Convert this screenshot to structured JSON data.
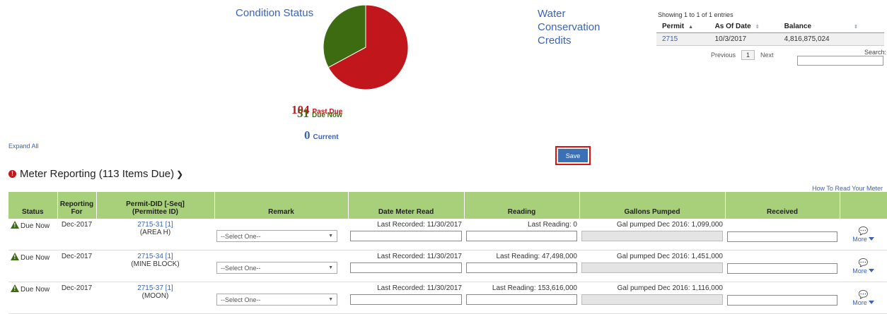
{
  "condition": {
    "title": "Condition Status",
    "past_due": {
      "count": "104",
      "label": "Past Due",
      "color": "#c0161c"
    },
    "due_now": {
      "count": "51",
      "label": "Due Now",
      "color": "#3d6b11"
    },
    "current": {
      "count": "0",
      "label": "Current",
      "color": "#3a63b8"
    }
  },
  "water": {
    "line1": "Water",
    "line2": "Conservation",
    "line3": "Credits"
  },
  "permits": {
    "showing": "Showing 1 to 1 of 1 entries",
    "headers": [
      "Permit",
      "As Of Date",
      "Balance"
    ],
    "rows": [
      {
        "permit": "2715",
        "date": "10/3/2017",
        "balance": "4,816,875,024"
      }
    ],
    "previous": "Previous",
    "page": "1",
    "next": "Next",
    "search_label": "Search:"
  },
  "expand_all": "Expand All",
  "save_label": "Save",
  "section": {
    "title": "Meter Reporting (113 Items Due)"
  },
  "how_to": "How To Read Your Meter",
  "table": {
    "headers": {
      "status": "Status",
      "reporting_line1": "Reporting",
      "reporting_line2": "For",
      "permit_line1": "Permit-DID [-Seq]",
      "permit_line2": "(Permittee ID)",
      "remark": "Remark",
      "date": "Date Meter Read",
      "reading": "Reading",
      "gallons": "Gallons Pumped",
      "received": "Received"
    },
    "rows": [
      {
        "status": "Due Now",
        "period": "Dec-2017",
        "permit": "2715-31 [1]",
        "permittee": "(AREA H)",
        "remark": "--Select One--",
        "last_recorded": "Last Recorded: 11/30/2017",
        "last_reading": "Last Reading: 0",
        "gallons": "Gal pumped Dec 2016: 1,099,000",
        "more": "More"
      },
      {
        "status": "Due Now",
        "period": "Dec-2017",
        "permit": "2715-34 [1]",
        "permittee": "(MINE BLOCK)",
        "remark": "--Select One--",
        "last_recorded": "Last Recorded: 11/30/2017",
        "last_reading": "Last Reading: 47,498,000",
        "gallons": "Gal pumped Dec 2016: 1,451,000",
        "more": "More"
      },
      {
        "status": "Due Now",
        "period": "Dec-2017",
        "permit": "2715-37 [1]",
        "permittee": "(MOON)",
        "remark": "--Select One--",
        "last_recorded": "Last Recorded: 11/30/2017",
        "last_reading": "Last Reading: 153,616,000",
        "gallons": "Gal pumped Dec 2016: 1,116,000",
        "more": "More"
      }
    ]
  },
  "chart_data": {
    "type": "pie",
    "categories": [
      "Past Due",
      "Due Now",
      "Current"
    ],
    "values": [
      104,
      51,
      0
    ],
    "colors": [
      "#c0161c",
      "#3d6b11",
      "#3a63b8"
    ]
  }
}
